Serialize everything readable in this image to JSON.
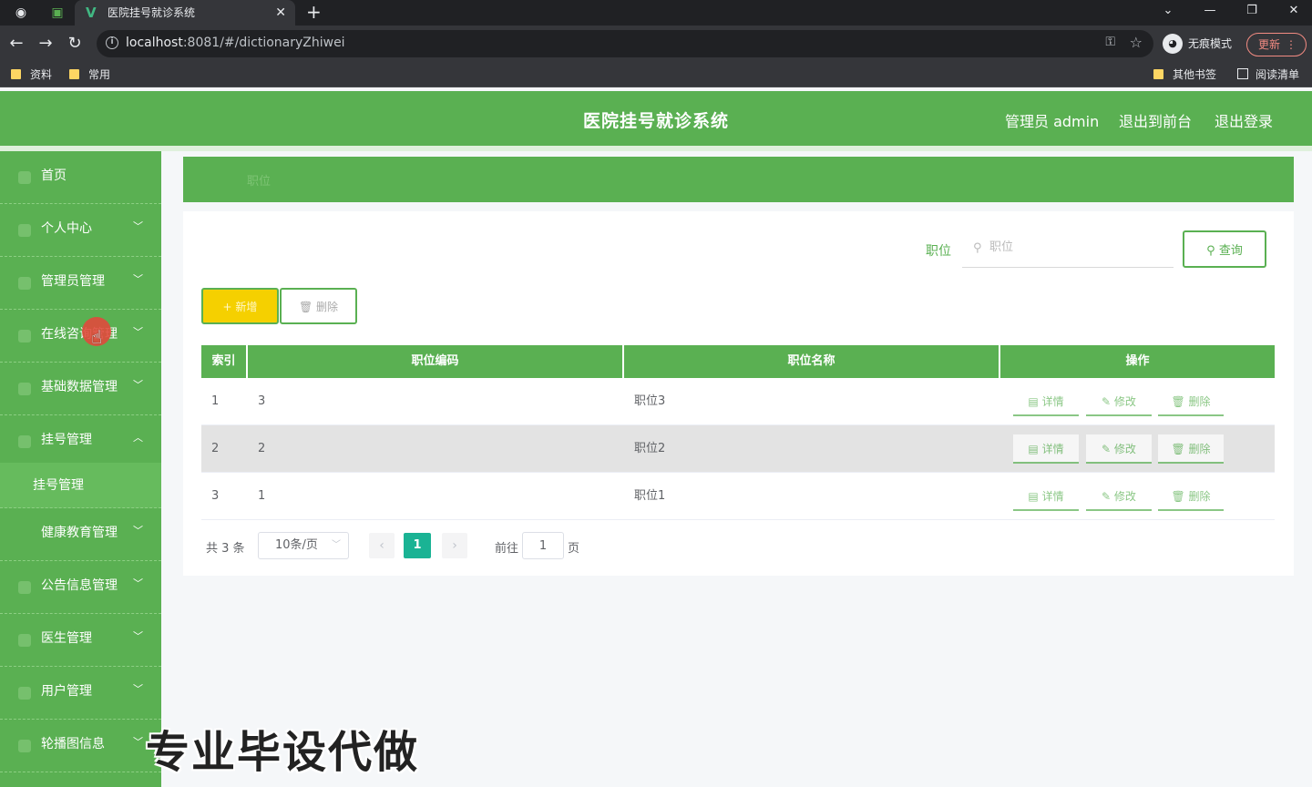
{
  "browser": {
    "tab_title": "医院挂号就诊系统",
    "url_host": "localhost",
    "url_rest": ":8081/#/dictionaryZhiwei",
    "incognito_label": "无痕模式",
    "update_label": "更新",
    "bookmarks": [
      "资料",
      "常用"
    ],
    "other_bookmarks": "其他书签",
    "reading_list": "阅读清单"
  },
  "header": {
    "title": "医院挂号就诊系统",
    "user": "管理员 admin",
    "to_front": "退出到前台",
    "logout": "退出登录"
  },
  "sidebar": {
    "items": [
      {
        "label": "首页",
        "chevron": ""
      },
      {
        "label": "个人中心",
        "chevron": "﹀"
      },
      {
        "label": "管理员管理",
        "chevron": "﹀"
      },
      {
        "label": "在线咨询管理",
        "chevron": "﹀"
      },
      {
        "label": "基础数据管理",
        "chevron": "﹀"
      },
      {
        "label": "挂号管理",
        "chevron": "︿"
      },
      {
        "label": "健康教育管理",
        "chevron": "﹀"
      },
      {
        "label": "公告信息管理",
        "chevron": "﹀"
      },
      {
        "label": "医生管理",
        "chevron": "﹀"
      },
      {
        "label": "用户管理",
        "chevron": "﹀"
      },
      {
        "label": "轮播图信息",
        "chevron": "﹀"
      }
    ],
    "submenu": "挂号管理"
  },
  "breadcrumb": "职位",
  "search": {
    "label": "职位",
    "placeholder": "职位",
    "button": "查询"
  },
  "actions": {
    "add": "新增",
    "delete": "删除"
  },
  "table": {
    "headers": [
      "索引",
      "职位编码",
      "职位名称",
      "操作"
    ],
    "rows": [
      {
        "index": "1",
        "code": "3",
        "name": "职位3"
      },
      {
        "index": "2",
        "code": "2",
        "name": "职位2"
      },
      {
        "index": "3",
        "code": "1",
        "name": "职位1"
      }
    ],
    "ops": {
      "detail": "详情",
      "edit": "修改",
      "delete": "删除"
    }
  },
  "pagination": {
    "total": "共 3 条",
    "page_size": "10条/页",
    "current": "1",
    "goto_label": "前往",
    "goto_value": "1",
    "page_suffix": "页"
  },
  "watermark": "专业毕设代做",
  "colors": {
    "accent": "#5ab052",
    "add_button": "#f5d000",
    "current_page": "#1ab394"
  }
}
